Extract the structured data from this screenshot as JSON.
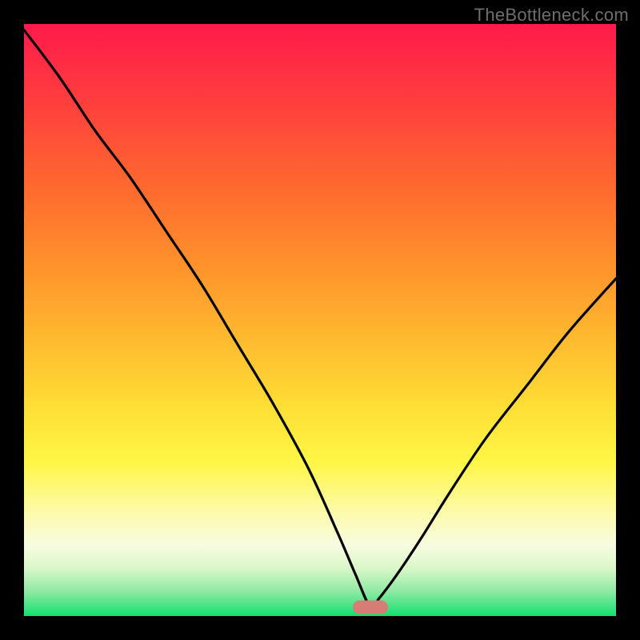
{
  "watermark": "TheBottleneck.com",
  "marker": {
    "x_frac": 0.585,
    "y_frac": 0.985
  },
  "colors": {
    "background": "#000000",
    "curve_stroke": "#000000",
    "marker_fill": "#d87d76",
    "watermark_color": "#6e6e6e",
    "gradient_stops": [
      "#ff1a4a",
      "#ff3b3f",
      "#ff6a2e",
      "#ff962c",
      "#ffc030",
      "#ffe237",
      "#fff646",
      "#fdfbb0",
      "#f8fce0",
      "#d9f7c9",
      "#8be9a1",
      "#12e06e"
    ]
  },
  "chart_data": {
    "type": "line",
    "title": "",
    "xlabel": "",
    "ylabel": "",
    "xlim": [
      0,
      100
    ],
    "ylim": [
      0,
      100
    ],
    "series": [
      {
        "name": "bottleneck-curve",
        "x": [
          0,
          6,
          12,
          18,
          24,
          30,
          36,
          42,
          48,
          53,
          56,
          58.5,
          60,
          63,
          67,
          72,
          78,
          85,
          92,
          100
        ],
        "values": [
          99,
          91,
          82,
          74,
          65,
          56,
          46,
          36,
          25,
          14,
          7,
          1.5,
          3,
          7,
          13,
          21,
          30,
          39,
          48,
          57
        ]
      }
    ],
    "annotations": [
      {
        "name": "optimal-marker",
        "x": 58.5,
        "y": 1.5
      }
    ]
  }
}
